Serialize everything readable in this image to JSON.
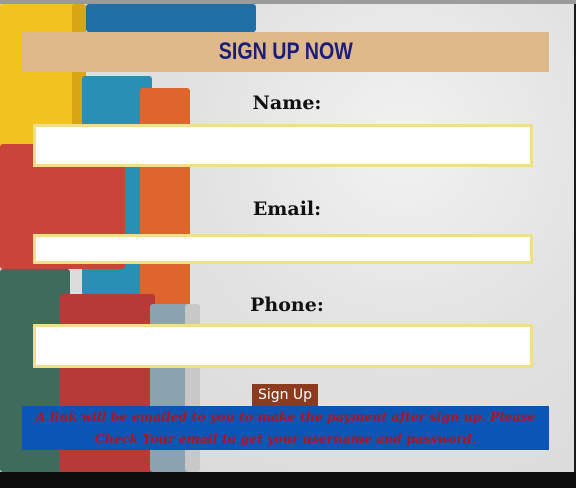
{
  "form": {
    "title": "SIGN UP NOW",
    "name_label": "Name:",
    "email_label": "Email:",
    "phone_label": "Phone:",
    "name_value": "",
    "email_value": "",
    "phone_value": "",
    "submit_label": "Sign Up",
    "notice": "A link will be emailed to you to make the payment after sign up. Please Check Your email to get your username and password."
  },
  "colors": {
    "header_bg": "#e0b98a",
    "title_color": "#1c1d78",
    "field_border": "#f0df8a",
    "button_bg": "#8c3b1f",
    "notice_bg": "#0b56b5",
    "notice_text": "#b0131e"
  }
}
